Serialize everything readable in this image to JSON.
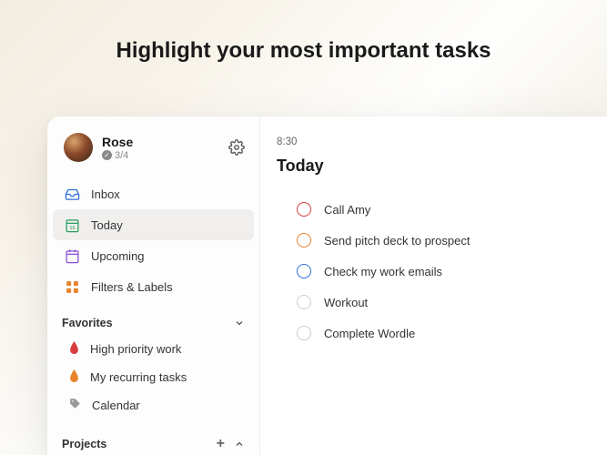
{
  "hero": "Highlight your most important tasks",
  "profile": {
    "name": "Rose",
    "progress": "3/4"
  },
  "nav": {
    "inbox": "Inbox",
    "today": "Today",
    "upcoming": "Upcoming",
    "filters": "Filters & Labels"
  },
  "sections": {
    "favorites": "Favorites",
    "projects": "Projects"
  },
  "favorites": [
    {
      "label": "High priority work"
    },
    {
      "label": "My recurring tasks"
    },
    {
      "label": "Calendar"
    }
  ],
  "main": {
    "time": "8:30",
    "title": "Today"
  },
  "tasks": [
    {
      "label": "Call Amy",
      "priority": "red"
    },
    {
      "label": "Send pitch deck to prospect",
      "priority": "orange"
    },
    {
      "label": "Check my work emails",
      "priority": "blue"
    },
    {
      "label": "Workout",
      "priority": "none"
    },
    {
      "label": "Complete Wordle",
      "priority": "none"
    }
  ]
}
